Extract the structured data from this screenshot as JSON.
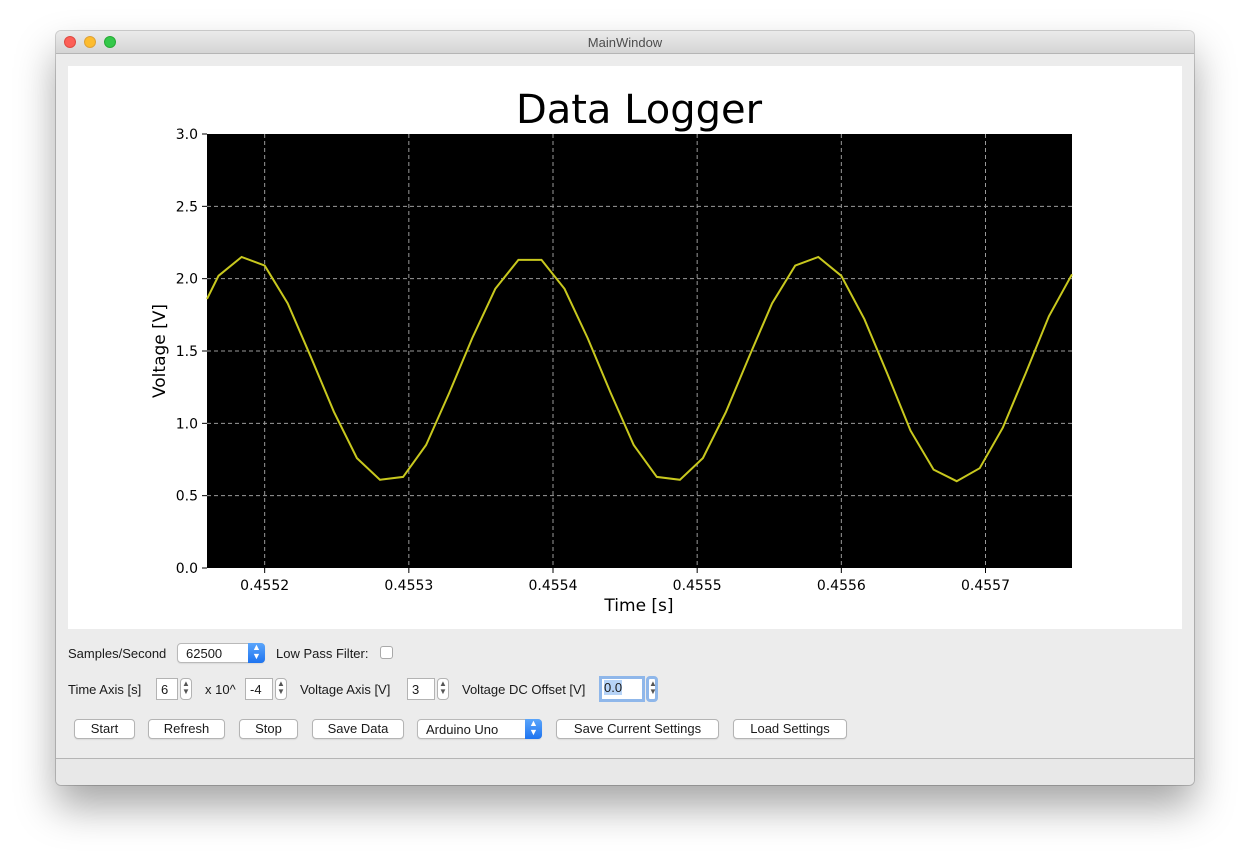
{
  "window": {
    "title": "MainWindow"
  },
  "chart_data": {
    "type": "line",
    "title": "Data Logger",
    "xlabel": "Time [s]",
    "ylabel": "Voltage [V]",
    "xlim": [
      0.45516,
      0.45576
    ],
    "ylim": [
      0.0,
      3.0
    ],
    "x_ticks": [
      "0.4552",
      "0.4553",
      "0.4554",
      "0.4555",
      "0.4556",
      "0.4557"
    ],
    "x_tick_values": [
      0.4552,
      0.4553,
      0.4554,
      0.4555,
      0.4556,
      0.4557
    ],
    "y_ticks": [
      "0.0",
      "0.5",
      "1.0",
      "1.5",
      "2.0",
      "2.5",
      "3.0"
    ],
    "y_tick_values": [
      0.0,
      0.5,
      1.0,
      1.5,
      2.0,
      2.5,
      3.0
    ],
    "grid": true,
    "background": "#000000",
    "series": [
      {
        "color": "#c8c81e",
        "x": [
          0.45516,
          0.455168,
          0.455184,
          0.4552,
          0.455216,
          0.455232,
          0.455248,
          0.455264,
          0.45528,
          0.455296,
          0.455312,
          0.455328,
          0.455344,
          0.45536,
          0.455376,
          0.455392,
          0.455408,
          0.455424,
          0.45544,
          0.455456,
          0.455472,
          0.455488,
          0.455504,
          0.45552,
          0.455536,
          0.455552,
          0.455568,
          0.455584,
          0.4556,
          0.455616,
          0.455632,
          0.455648,
          0.455664,
          0.45568,
          0.455696,
          0.455712,
          0.455728,
          0.455744,
          0.45576
        ],
        "y": [
          1.86,
          2.02,
          2.15,
          2.09,
          1.83,
          1.46,
          1.08,
          0.76,
          0.61,
          0.63,
          0.85,
          1.21,
          1.59,
          1.93,
          2.13,
          2.13,
          1.93,
          1.59,
          1.21,
          0.85,
          0.63,
          0.61,
          0.76,
          1.08,
          1.46,
          1.83,
          2.09,
          2.15,
          2.02,
          1.72,
          1.34,
          0.95,
          0.68,
          0.6,
          0.69,
          0.97,
          1.35,
          1.74,
          2.03
        ]
      }
    ]
  },
  "controls": {
    "samples_label": "Samples/Second",
    "samples_value": "62500",
    "lowpass_label": "Low Pass Filter:",
    "lowpass_checked": false,
    "time_axis_label": "Time Axis [s]",
    "time_axis_value": "6",
    "exp_label": "x 10^",
    "exp_value": "-4",
    "voltage_axis_label": "Voltage Axis [V]",
    "voltage_axis_value": "3",
    "dc_offset_label": "Voltage DC Offset [V]",
    "dc_offset_value": "0.0",
    "buttons": {
      "start": "Start",
      "refresh": "Refresh",
      "stop": "Stop",
      "save_data": "Save Data",
      "save_settings": "Save Current Settings",
      "load_settings": "Load Settings"
    },
    "board_value": "Arduino Uno"
  }
}
